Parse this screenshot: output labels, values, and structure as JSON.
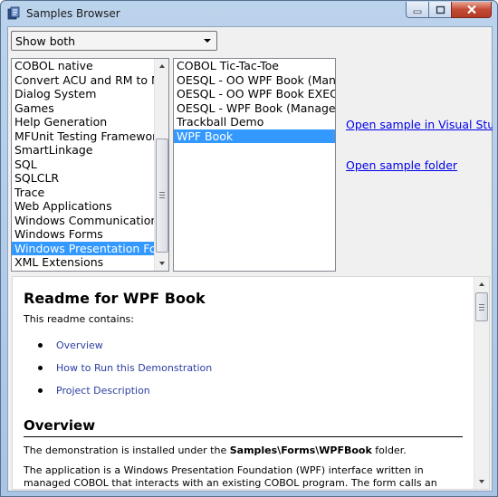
{
  "window": {
    "title": "Samples Browser",
    "accent": "#3399ff"
  },
  "filter": {
    "selected": "Show both"
  },
  "categories": [
    {
      "label": "COBOL native",
      "selected": false
    },
    {
      "label": "Convert ACU and RM to MF",
      "selected": false
    },
    {
      "label": "Dialog System",
      "selected": false
    },
    {
      "label": "Games",
      "selected": false
    },
    {
      "label": "Help Generation",
      "selected": false
    },
    {
      "label": "MFUnit Testing Framework",
      "selected": false
    },
    {
      "label": "SmartLinkage",
      "selected": false
    },
    {
      "label": "SQL",
      "selected": false
    },
    {
      "label": "SQLCLR",
      "selected": false
    },
    {
      "label": "Trace",
      "selected": false
    },
    {
      "label": "Web Applications",
      "selected": false
    },
    {
      "label": "Windows Communication Foundation",
      "selected": false
    },
    {
      "label": "Windows Forms",
      "selected": false
    },
    {
      "label": "Windows Presentation Foundation",
      "selected": true
    },
    {
      "label": "XML Extensions",
      "selected": false
    }
  ],
  "samples": [
    {
      "label": "COBOL Tic-Tac-Toe",
      "selected": false
    },
    {
      "label": "OESQL - OO WPF Book (Managed)",
      "selected": false
    },
    {
      "label": "OESQL - OO WPF Book EXEC",
      "selected": false
    },
    {
      "label": "OESQL - WPF Book (Managed)",
      "selected": false
    },
    {
      "label": "Trackball Demo",
      "selected": false
    },
    {
      "label": "WPF Book",
      "selected": true
    }
  ],
  "actions": {
    "open_vs": "Open sample in Visual Studio",
    "open_folder": "Open sample folder"
  },
  "readme": {
    "title": "Readme for WPF Book",
    "intro": "This readme contains:",
    "toc": [
      "Overview",
      "How to Run this Demonstration",
      "Project Description"
    ],
    "overview_heading": "Overview",
    "para1_prefix": "The demonstration is installed under the ",
    "para1_path": "Samples\\Forms\\WPFBook",
    "para1_suffix": " folder.",
    "para2": "The application is a Windows Presentation Foundation (WPF) interface written in managed COBOL that interacts with an existing COBOL program. The form calls an"
  }
}
